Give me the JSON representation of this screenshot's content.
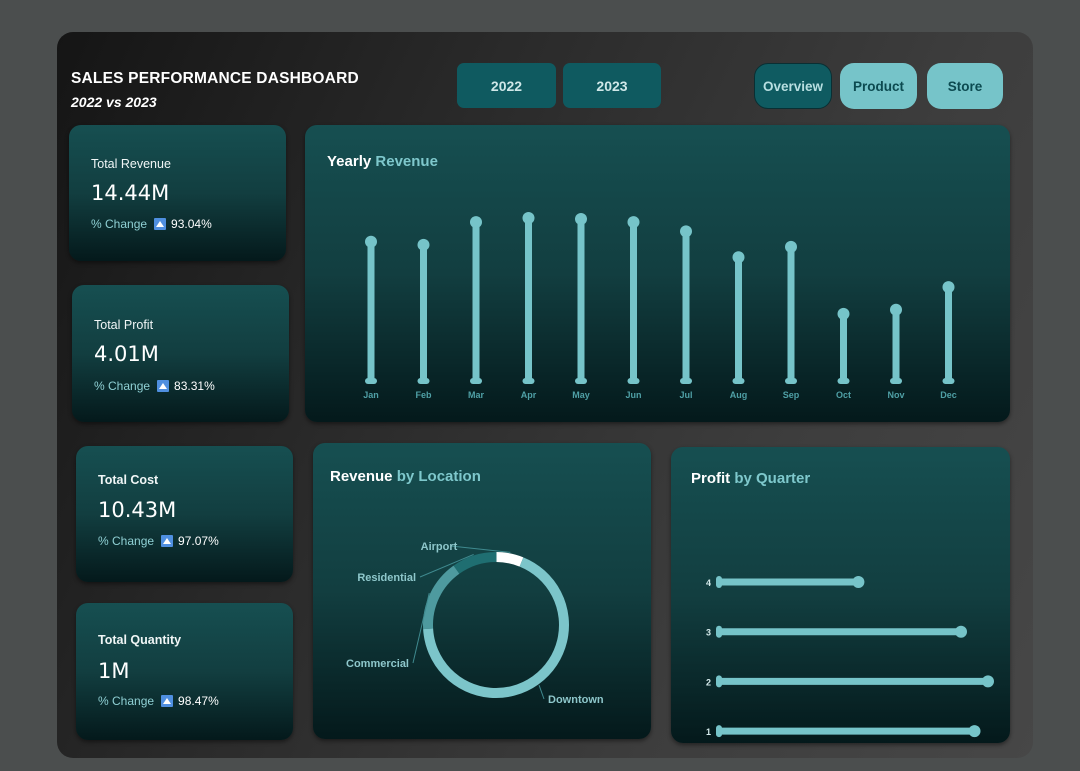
{
  "header": {
    "title": "SALES PERFORMANCE DASHBOARD",
    "subtitle": "2022 vs 2023"
  },
  "year_filter": [
    "2022",
    "2023"
  ],
  "nav": {
    "items": [
      {
        "label": "Overview",
        "active": true
      },
      {
        "label": "Product",
        "active": false
      },
      {
        "label": "Store",
        "active": false
      }
    ]
  },
  "kpis": [
    {
      "label": "Total Revenue",
      "value": "14.44M",
      "change_label": "% Change",
      "change": "93.04%"
    },
    {
      "label": "Total Profit",
      "value": "4.01M",
      "change_label": "% Change",
      "change": "83.31%"
    },
    {
      "label": "Total Cost",
      "value": "10.43M",
      "change_label": "% Change",
      "change": "97.07%"
    },
    {
      "label": "Total Quantity",
      "value": "1M",
      "change_label": "% Change",
      "change": "98.47%"
    }
  ],
  "panels": {
    "yearly": {
      "title_a": "Yearly",
      "title_b": "Revenue"
    },
    "location": {
      "title_a": "Revenue",
      "title_b": "by Location"
    },
    "quarter": {
      "title_a": "Profit",
      "title_b": "by Quarter"
    }
  },
  "colors": {
    "accent": "#76c4c9",
    "dark_teal": "#0f5a60",
    "up_arrow": "#4f8fe0"
  },
  "chart_data": [
    {
      "type": "bar",
      "categories": [
        "Jan",
        "Feb",
        "Mar",
        "Apr",
        "May",
        "Jun",
        "Jul",
        "Aug",
        "Sep",
        "Oct",
        "Nov",
        "Dec"
      ],
      "values": [
        1.36,
        1.33,
        1.55,
        1.59,
        1.58,
        1.55,
        1.46,
        1.21,
        1.31,
        0.66,
        0.7,
        0.92
      ],
      "title": "Yearly Revenue",
      "style": "lollipop",
      "grid": false
    },
    {
      "type": "pie",
      "style": "donut",
      "labels": [
        "Airport",
        "Residential",
        "Commercial",
        "Downtown"
      ],
      "values": [
        6,
        10,
        16,
        68
      ],
      "colors": [
        "#ffffff",
        "#1f6e71",
        "#4e9a9f",
        "#7cc5ca"
      ],
      "title": "Revenue by Location"
    },
    {
      "type": "bar",
      "orientation": "horizontal",
      "style": "lollipop",
      "categories": [
        "4",
        "3",
        "2",
        "1"
      ],
      "values": [
        0.52,
        0.9,
        1.0,
        0.95
      ],
      "title": "Profit by Quarter",
      "grid": false
    }
  ]
}
